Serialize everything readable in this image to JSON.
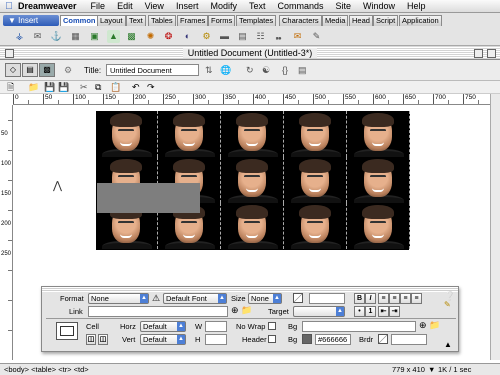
{
  "menubar": {
    "app_name": "Dreamweaver",
    "items": [
      "File",
      "Edit",
      "View",
      "Insert",
      "Modify",
      "Text",
      "Commands",
      "Site",
      "Window",
      "Help"
    ]
  },
  "insert_bar": {
    "label": "Insert",
    "tabs": [
      "Common",
      "Layout",
      "Text",
      "Tables",
      "Frames",
      "Forms",
      "Templates",
      "Characters",
      "Media",
      "Head",
      "Script",
      "Application"
    ],
    "active_tab": "Common"
  },
  "document": {
    "window_title": "Untitled Document (Untitled-3*)",
    "title_label": "Title:",
    "title_value": "Untitled Document"
  },
  "ruler": {
    "labels": [
      "0",
      "50",
      "100",
      "150",
      "200",
      "250",
      "300",
      "350",
      "400",
      "450",
      "500",
      "550",
      "600",
      "650",
      "700",
      "750"
    ],
    "vlabels": [
      "50",
      "100",
      "150",
      "200",
      "250"
    ]
  },
  "property_inspector": {
    "format_label": "Format",
    "format_value": "None",
    "font_value": "Default Font",
    "size_label": "Size",
    "size_value": "None",
    "link_label": "Link",
    "target_label": "Target",
    "cell_label": "Cell",
    "horz_label": "Horz",
    "horz_value": "Default",
    "vert_label": "Vert",
    "vert_value": "Default",
    "w_label": "W",
    "h_label": "H",
    "nowrap_label": "No Wrap",
    "header_label": "Header",
    "bg_label": "Bg",
    "bg2_label": "Bg",
    "bg_color_value": "#666666",
    "brdr_label": "Brdr",
    "bold": "B",
    "italic": "I"
  },
  "statusbar": {
    "tags": "<body> <table> <tr> <td>",
    "dimensions": "779 x 410",
    "download": "1K / 1 sec"
  },
  "colors": {
    "tab_active_text": "#1a4fb5",
    "cell_bg": "#666666"
  }
}
